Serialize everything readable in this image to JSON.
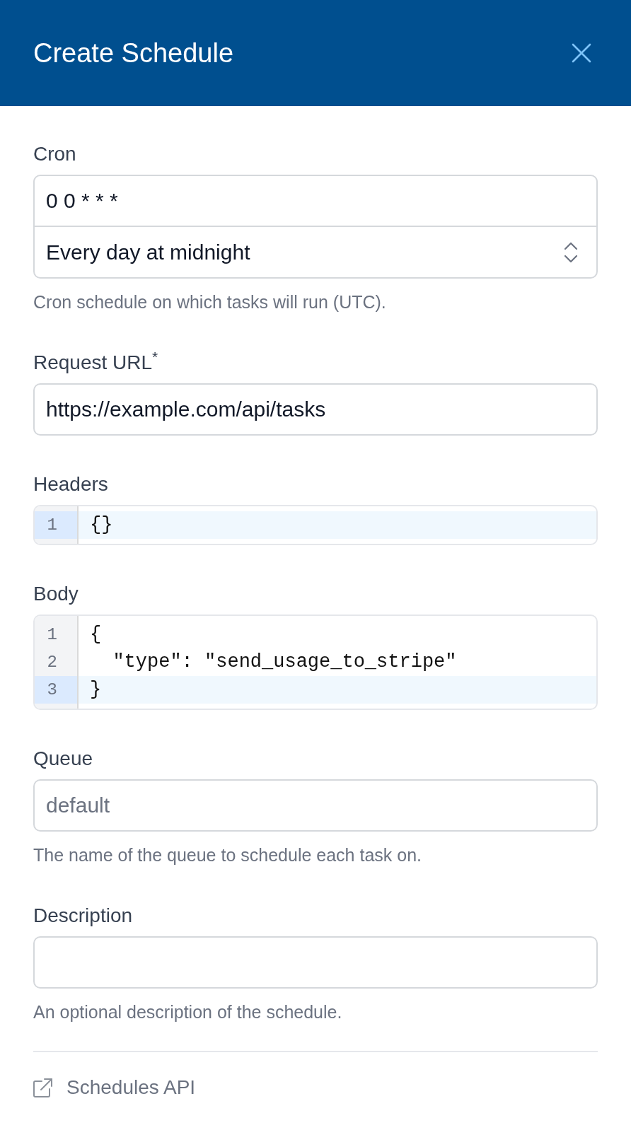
{
  "header": {
    "title": "Create Schedule"
  },
  "fields": [
    {
      "kind": "cron",
      "label": "Cron",
      "value": "0 0 * * *",
      "preset": "Every day at midnight",
      "help": "Cron schedule on which tasks will run (UTC)."
    },
    {
      "kind": "text",
      "label": "Request URL$^{*}$",
      "value": "https://example.com/api/tasks"
    },
    {
      "kind": "code",
      "label": "Headers",
      "lines": [
        {
          "number": "1",
          "code": "{}",
          "active": true
        }
      ]
    },
    {
      "kind": "code",
      "label": "Body",
      "lines": [
        {
          "number": "1",
          "code": "{",
          "active": false
        },
        {
          "number": "2",
          "code": "  \"type\": \"send_usage_to_stripe\"",
          "active": false
        },
        {
          "number": "3",
          "code": "}",
          "active": true
        }
      ]
    },
    {
      "kind": "text",
      "label": "Queue",
      "placeholder": "default",
      "help": "The name of the queue to schedule each task on."
    },
    {
      "kind": "text",
      "label": "Description",
      "help": "An optional description of the schedule."
    }
  ],
  "footer": {
    "link": "Schedules API"
  }
}
